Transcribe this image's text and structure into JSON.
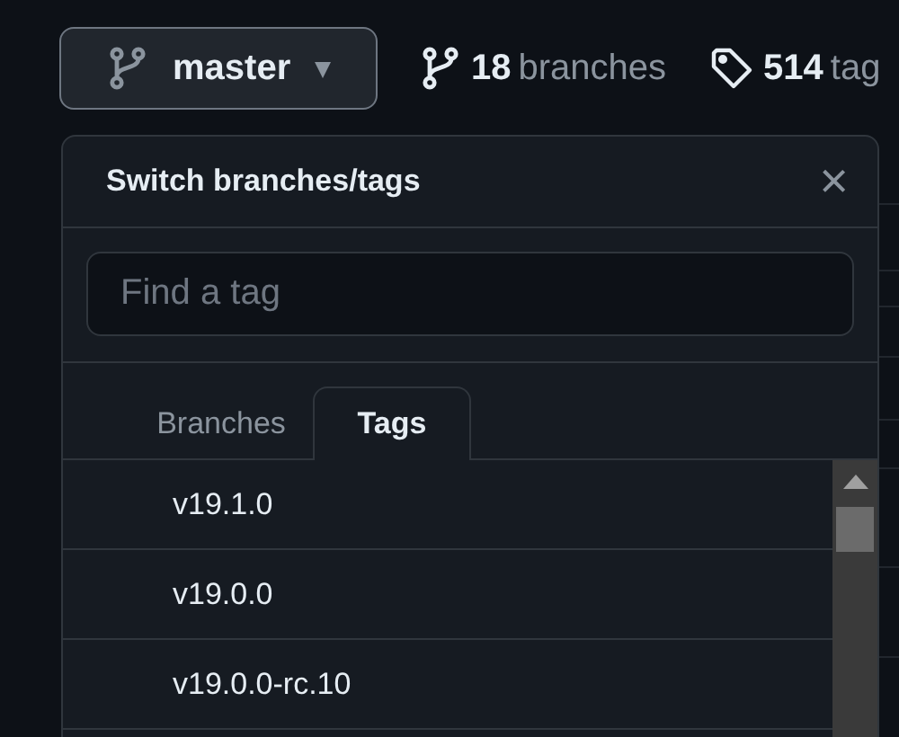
{
  "branch_button": {
    "label": "master",
    "caret": "▾"
  },
  "branch_count": {
    "count": "18",
    "label": "branches"
  },
  "tag_count": {
    "count": "514",
    "label": "tag"
  },
  "dropdown": {
    "title": "Switch branches/tags",
    "close": "×",
    "search": {
      "placeholder": "Find a tag"
    },
    "tabs": [
      {
        "label": "Branches",
        "selected": false
      },
      {
        "label": "Tags",
        "selected": true
      }
    ],
    "items": [
      {
        "label": "v19.1.0"
      },
      {
        "label": "v19.0.0"
      },
      {
        "label": "v19.0.0-rc.10"
      }
    ]
  }
}
